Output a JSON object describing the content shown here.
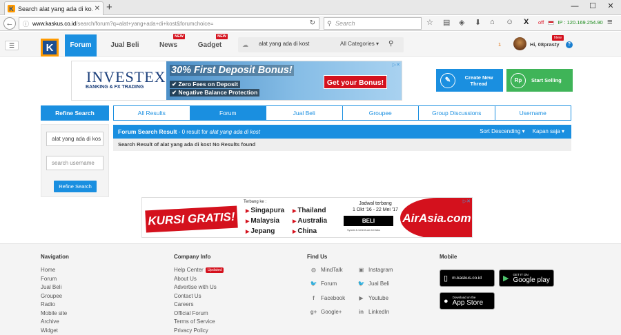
{
  "browser": {
    "tab_title": "Search alat yang ada di ko...",
    "url_host": "www.kaskus.co.id",
    "url_path": "/search/forum?q=alat+yang+ada+di+kost&forumchoice=",
    "search_placeholder": "Search",
    "proxy_status": "off",
    "ip_label": "IP : 120.169.254.90"
  },
  "header": {
    "nav": [
      {
        "label": "Forum",
        "badge": ""
      },
      {
        "label": "Jual Beli",
        "badge": ""
      },
      {
        "label": "News",
        "badge": "NEW"
      },
      {
        "label": "Gadget",
        "badge": "NEW"
      }
    ],
    "search_value": "alat yang ada di kost",
    "category": "All Categories",
    "notif_count": "1",
    "username": "Hi, 08prasty",
    "user_badge": "New"
  },
  "ad_top": {
    "brand": "INVESTEX",
    "brand_sub": "BANKING & FX TRADING",
    "headline": "30% First Deposit Bonus!",
    "bullets": [
      "Zero Fees on Deposit",
      "Negative Balance Protection"
    ],
    "cta": "Get your Bonus!"
  },
  "actions": {
    "create_thread_line1": "Create New",
    "create_thread_line2": "Thread",
    "start_selling": "Start Selling",
    "sell_icon": "Rp"
  },
  "refine": {
    "title": "Refine Search",
    "keyword": "alat yang ada di kos",
    "username_placeholder": "search username",
    "button": "Refine Search"
  },
  "tabs": [
    "All Results",
    "Forum",
    "Jual Beli",
    "Groupee",
    "Group Discussions",
    "Username"
  ],
  "results": {
    "title": "Forum Search Result",
    "summary": " - 0 result for ",
    "query": "alat yang ada di kost",
    "sort": "Sort Descending",
    "time": "Kapan saja",
    "message": "Search Result of alat yang ada di kost No Results found"
  },
  "ad_bottom": {
    "headline": "KURSI GRATIS!",
    "label": "Terbang ke :",
    "cities": [
      "Singapura",
      "Thailand",
      "Malaysia",
      "Australia",
      "Jepang",
      "China"
    ],
    "schedule_title": "Jadwal terbang",
    "schedule_dates": "1 Okt '16 - 22 Mei '17",
    "cta": "BELI",
    "terms": "Syarat & ketentuan berlaku",
    "brand": "AirAsia.com"
  },
  "footer": {
    "nav_title": "Navigation",
    "nav_links": [
      "Home",
      "Forum",
      "Jual Beli",
      "Groupee",
      "Radio",
      "Mobile site",
      "Archive",
      "Widget"
    ],
    "company_title": "Company Info",
    "company_links": [
      "Help Center",
      "About Us",
      "Advertise with Us",
      "Contact Us",
      "Careers",
      "Official Forum",
      "Terms of Service",
      "Privacy Policy"
    ],
    "updated_badge": "Updated",
    "findus_title": "Find Us",
    "findus_left": [
      "MindTalk",
      "Forum",
      "Facebook",
      "Google+"
    ],
    "findus_right": [
      "Instagram",
      "Jual Beli",
      "Youtube",
      "LinkedIn"
    ],
    "mobile_title": "Mobile",
    "mobile_site": "m.kaskus.co.id",
    "gplay_small": "GET IT ON",
    "gplay": "Google play",
    "appstore_small": "Download on the",
    "appstore": "App Store"
  }
}
